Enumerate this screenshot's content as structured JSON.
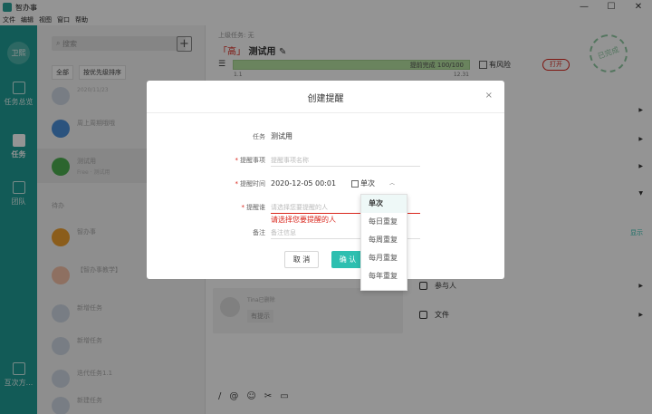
{
  "window": {
    "title": "智办事",
    "controls": [
      "—",
      "☐",
      "✕"
    ]
  },
  "menu": [
    "文件",
    "编辑",
    "视图",
    "窗口",
    "帮助"
  ],
  "rail": {
    "avatar_text": "卫熙",
    "items": [
      {
        "label": "任务总览"
      },
      {
        "label": "任务"
      },
      {
        "label": "团队"
      },
      {
        "label": "互次方..."
      }
    ]
  },
  "list": {
    "search_placeholder": "搜索",
    "add_label": "+",
    "filters": [
      "全部",
      "按优先级排序"
    ],
    "section_label": "待办",
    "items": [
      {
        "title": "周上周期哦哦",
        "meta": "2020/11/23"
      },
      {
        "title": "测试用",
        "meta": "Free · 测试用"
      },
      {
        "title": "智办事",
        "meta": ""
      },
      {
        "title": "【智办事教学】",
        "meta": ""
      },
      {
        "title": "新增任务",
        "meta": ""
      },
      {
        "title": "新增任务",
        "meta": ""
      },
      {
        "title": "迭代任务1.1",
        "meta": ""
      },
      {
        "title": "新建任务",
        "meta": ""
      }
    ]
  },
  "detail": {
    "parent_task": "上级任务: 无",
    "priority_tag": "「高」",
    "task_title": "测试用",
    "progress_label": "提前完成 100/100",
    "progress_value": 1.0,
    "progress_left": "1.1",
    "progress_right": "12.31",
    "risk_label": "有风险",
    "open_label": "打开",
    "stamp_text": "已完成",
    "side_rows": [
      {
        "label": "参与人"
      },
      {
        "label": "文件"
      }
    ],
    "side_right_link": "显示",
    "comment": {
      "name": "Tina已删除",
      "message": "有提示"
    },
    "composer_icons": [
      "/",
      "@",
      "☺",
      "✂",
      "▭"
    ]
  },
  "modal": {
    "title": "创建提醒",
    "close": "×",
    "fields": {
      "task_label": "任务",
      "task_value": "测试用",
      "reminder_label": "提醒事项",
      "reminder_placeholder": "提醒事项名称",
      "time_label": "提醒时间",
      "time_value": "2020-12-05 00:01",
      "frequency_value": "单次",
      "recipient_label": "提醒谁",
      "recipient_placeholder": "请选择您要提醒的人",
      "recipient_error": "请选择您要提醒的人",
      "note_label": "备注",
      "note_placeholder": "备注信息"
    },
    "cancel_label": "取 消",
    "ok_label": "确 认"
  },
  "frequency_options": [
    "单次",
    "每日重复",
    "每周重复",
    "每月重复",
    "每年重复"
  ],
  "colors": {
    "teal": "#1f9e96",
    "accent": "#2dbfb0",
    "error": "#d9261c"
  }
}
